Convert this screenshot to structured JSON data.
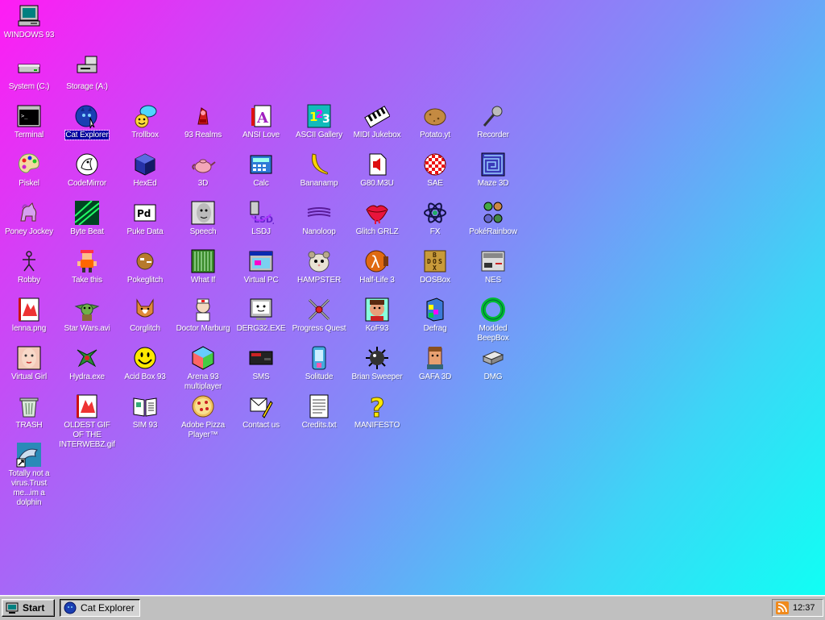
{
  "desktop": {
    "icons": [
      {
        "id": "windows93",
        "label": "WINDOWS 93",
        "icon": "computer-icon"
      },
      {
        "id": "system",
        "label": "System (C:)",
        "icon": "hard-drive-icon"
      },
      {
        "id": "storage",
        "label": "Storage (A:)",
        "icon": "floppy-drive-icon"
      },
      {
        "id": "terminal",
        "label": "Terminal",
        "icon": "terminal-icon"
      },
      {
        "id": "cat-explorer",
        "label": "Cat Explorer",
        "icon": "globe-cat-icon"
      },
      {
        "id": "trollbox",
        "label": "Trollbox",
        "icon": "chat-bubble-icon"
      },
      {
        "id": "93-realms",
        "label": "93 Realms",
        "icon": "realms-icon"
      },
      {
        "id": "ansi-love",
        "label": "ANSI Love",
        "icon": "letter-a-icon"
      },
      {
        "id": "ascii-gallery",
        "label": "ASCII Gallery",
        "icon": "numbers-icon"
      },
      {
        "id": "midi-jukebox",
        "label": "MIDI Jukebox",
        "icon": "piano-keys-icon"
      },
      {
        "id": "potato",
        "label": "Potato.yt",
        "icon": "potato-icon"
      },
      {
        "id": "recorder",
        "label": "Recorder",
        "icon": "microphone-icon"
      },
      {
        "id": "piskel",
        "label": "Piskel",
        "icon": "palette-icon"
      },
      {
        "id": "codemirror",
        "label": "CodeMirror",
        "icon": "codemirror-icon"
      },
      {
        "id": "hexed",
        "label": "HexEd",
        "icon": "hex-cube-icon"
      },
      {
        "id": "3d",
        "label": "3D",
        "icon": "teapot-icon"
      },
      {
        "id": "calc",
        "label": "Calc",
        "icon": "calculator-icon"
      },
      {
        "id": "bananamp",
        "label": "Bananamp",
        "icon": "banana-icon"
      },
      {
        "id": "g80m3u",
        "label": "G80.M3U",
        "icon": "playlist-icon"
      },
      {
        "id": "sae",
        "label": "SAE",
        "icon": "amiga-ball-icon"
      },
      {
        "id": "maze3d",
        "label": "Maze 3D",
        "icon": "maze-icon"
      },
      {
        "id": "poney",
        "label": "Poney Jockey",
        "icon": "pony-icon"
      },
      {
        "id": "bytebeat",
        "label": "Byte Beat",
        "icon": "bytebeat-icon"
      },
      {
        "id": "pukedata",
        "label": "Puke Data",
        "icon": "pd-icon"
      },
      {
        "id": "speech",
        "label": "Speech",
        "icon": "face-icon"
      },
      {
        "id": "lsdj",
        "label": "LSDJ",
        "icon": "lsdj-icon"
      },
      {
        "id": "nanoloop",
        "label": "Nanoloop",
        "icon": "wave-icon"
      },
      {
        "id": "glitchgrlz",
        "label": "Glitch GRLZ",
        "icon": "lips-icon"
      },
      {
        "id": "fx",
        "label": "FX",
        "icon": "atom-icon"
      },
      {
        "id": "pokerainbow",
        "label": "PokéRainbow",
        "icon": "pokemon-trio-icon"
      },
      {
        "id": "robby",
        "label": "Robby",
        "icon": "stick-figure-icon"
      },
      {
        "id": "takethis",
        "label": "Take this",
        "icon": "sprite-man-icon"
      },
      {
        "id": "pokeglitch",
        "label": "Pokeglitch",
        "icon": "pokeglitch-icon"
      },
      {
        "id": "whatif",
        "label": "What If",
        "icon": "what-if-icon"
      },
      {
        "id": "virtualpc",
        "label": "Virtual PC",
        "icon": "window-pc-icon"
      },
      {
        "id": "hampster",
        "label": "HAMPSTER",
        "icon": "hamster-icon"
      },
      {
        "id": "halflife3",
        "label": "Half-Life 3",
        "icon": "lambda-icon"
      },
      {
        "id": "dosbox",
        "label": "DOSBox",
        "icon": "dosbox-icon"
      },
      {
        "id": "nes",
        "label": "NES",
        "icon": "nes-console-icon"
      },
      {
        "id": "lenna",
        "label": "lenna.png",
        "icon": "image-file-icon"
      },
      {
        "id": "starwars",
        "label": "Star Wars.avi",
        "icon": "yoda-icon"
      },
      {
        "id": "corglitch",
        "label": "Corglitch",
        "icon": "corgi-icon"
      },
      {
        "id": "doctor",
        "label": "Doctor Marburg",
        "icon": "doctor-icon"
      },
      {
        "id": "derg32",
        "label": "DERG32.EXE",
        "icon": "monitor-face-icon"
      },
      {
        "id": "progressquest",
        "label": "Progress Quest",
        "icon": "crossed-swords-icon"
      },
      {
        "id": "kof93",
        "label": "KoF93",
        "icon": "fighter-portrait-icon"
      },
      {
        "id": "defrag",
        "label": "Defrag",
        "icon": "defrag-icon"
      },
      {
        "id": "beepbox",
        "label": "Modded BeepBox",
        "icon": "green-ring-icon"
      },
      {
        "id": "virtualgirl",
        "label": "Virtual Girl",
        "icon": "girl-portrait-icon"
      },
      {
        "id": "hydra",
        "label": "Hydra.exe",
        "icon": "hydra-icon"
      },
      {
        "id": "acidbox",
        "label": "Acid Box 93",
        "icon": "smiley-icon"
      },
      {
        "id": "arena93",
        "label": "Arena 93 multiplayer",
        "icon": "cube-icon"
      },
      {
        "id": "sms",
        "label": "SMS",
        "icon": "console-icon"
      },
      {
        "id": "solitude",
        "label": "Solitude",
        "icon": "solitude-icon"
      },
      {
        "id": "briansweeper",
        "label": "Brian Sweeper",
        "icon": "mine-icon"
      },
      {
        "id": "gafa3d",
        "label": "GAFA 3D",
        "icon": "guy-face-icon"
      },
      {
        "id": "dmg",
        "label": "DMG",
        "icon": "drive-box-icon"
      },
      {
        "id": "trash",
        "label": "TRASH",
        "icon": "trash-icon"
      },
      {
        "id": "oldestgif",
        "label": "OLDEST GIF OF THE INTERWEBZ.gif",
        "icon": "image-file-icon"
      },
      {
        "id": "sim93",
        "label": "SIM 93",
        "icon": "book-icon"
      },
      {
        "id": "adobepizza",
        "label": "Adobe Pizza Player™",
        "icon": "pizza-icon"
      },
      {
        "id": "contactus",
        "label": "Contact us",
        "icon": "letter-pen-icon"
      },
      {
        "id": "credits",
        "label": "Credits.txt",
        "icon": "text-file-icon"
      },
      {
        "id": "manifesto",
        "label": "MANIFESTO",
        "icon": "question-mark-icon"
      },
      {
        "id": "dolphin",
        "label": "Totally not a virus.Trust me...im a dolphin",
        "icon": "dolphin-shortcut-icon"
      }
    ],
    "selected": "cat-explorer"
  },
  "taskbar": {
    "start_label": "Start",
    "task_label": "Cat Explorer",
    "clock": "12:37",
    "tray_icon": "rss-icon"
  },
  "colors": {
    "gradient_start": "#ff1cf4",
    "gradient_end": "#10fff4",
    "selection": "#0000a8",
    "taskbar": "#c0c0c0"
  }
}
